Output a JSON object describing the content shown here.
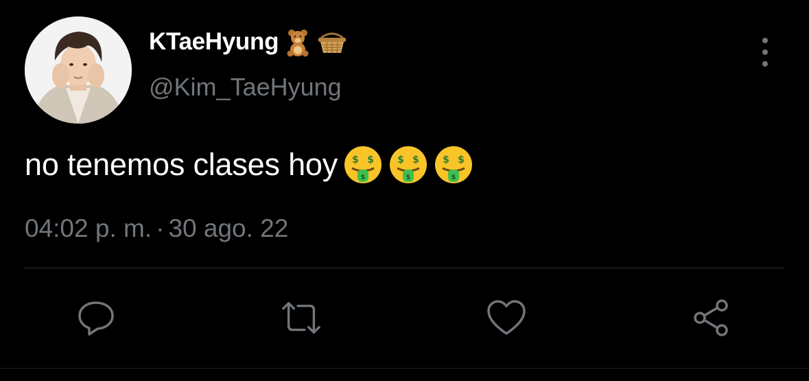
{
  "tweet": {
    "author": {
      "display_name": "KTaeHyung",
      "name_icons": [
        "teddy-bear-icon",
        "basket-icon"
      ],
      "handle": "@Kim_TaeHyung",
      "avatar": "profile-photo"
    },
    "text": "no tenemos clases hoy",
    "text_emojis": [
      "money-mouth-face-icon",
      "money-mouth-face-icon",
      "money-mouth-face-icon"
    ],
    "time": "04:02 p. m.",
    "separator": "·",
    "date": "30 ago. 22",
    "actions": [
      "reply-icon",
      "retweet-icon",
      "like-icon",
      "share-icon"
    ],
    "menu_icon": "more-vertical-icon"
  },
  "colors": {
    "background": "#000000",
    "primary_text": "#ffffff",
    "secondary_text": "#71767b",
    "divider": "#2f3336",
    "icon": "#71767b"
  }
}
